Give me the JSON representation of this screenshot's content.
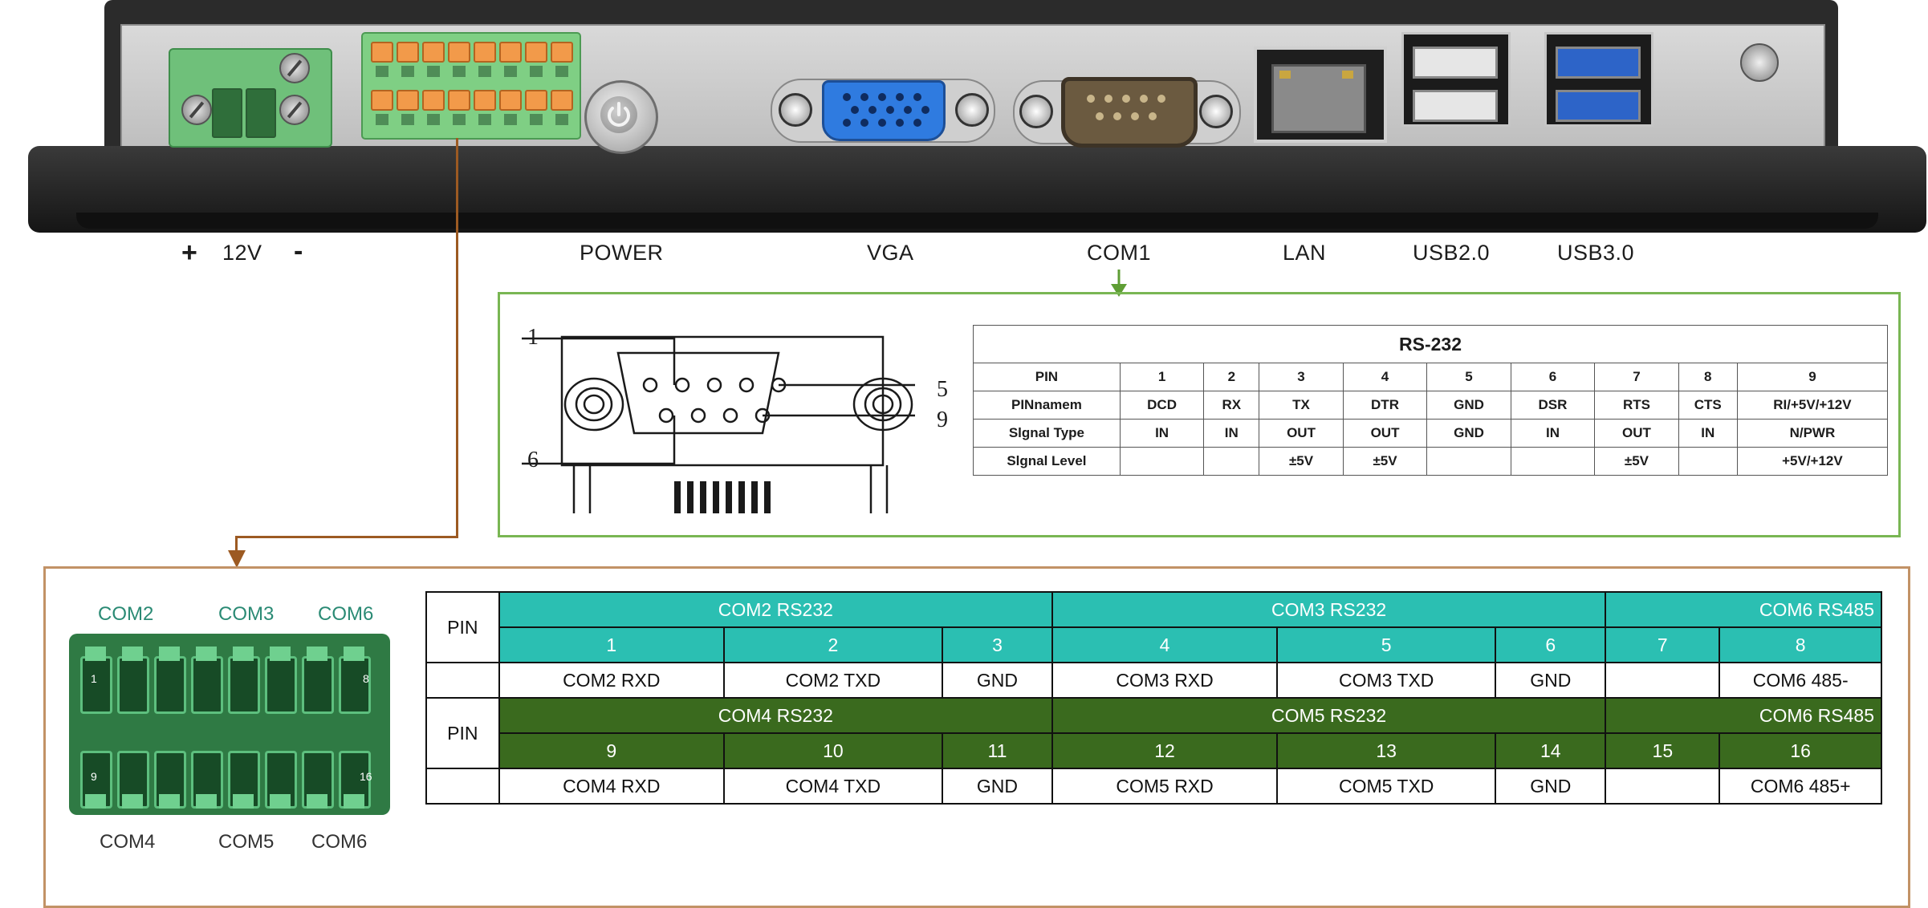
{
  "ports": {
    "power_plus": "+",
    "power_voltage": "12V",
    "power_minus": "-",
    "power_button": "POWER",
    "vga": "VGA",
    "com1": "COM1",
    "lan": "LAN",
    "usb2": "USB2.0",
    "usb3": "USB3.0"
  },
  "rs232_diagram": {
    "pin1_label": "1",
    "pin5_label": "5",
    "pin6_label": "6",
    "pin9_label": "9"
  },
  "rs232_table": {
    "title": "RS-232",
    "rows": [
      {
        "label": "PIN",
        "cells": [
          "1",
          "2",
          "3",
          "4",
          "5",
          "6",
          "7",
          "8",
          "9"
        ]
      },
      {
        "label": "PINnamem",
        "cells": [
          "DCD",
          "RX",
          "TX",
          "DTR",
          "GND",
          "DSR",
          "RTS",
          "CTS",
          "RI/+5V/+12V"
        ]
      },
      {
        "label": "Slgnal Type",
        "cells": [
          "IN",
          "IN",
          "OUT",
          "OUT",
          "GND",
          "IN",
          "OUT",
          "IN",
          "N/PWR"
        ]
      },
      {
        "label": "Slgnal Level",
        "cells": [
          "",
          "",
          "±5V",
          "±5V",
          "",
          "",
          "±5V",
          "",
          "+5V/+12V"
        ]
      }
    ]
  },
  "terminal_labels": {
    "top": [
      "COM2",
      "COM3",
      "COM6"
    ],
    "bottom": [
      "COM4",
      "COM5",
      "COM6"
    ],
    "pin_top_first": "1",
    "pin_top_last": "8",
    "pin_bottom_first": "9",
    "pin_bottom_last": "16"
  },
  "com_table": {
    "pin_label": "PIN",
    "top": {
      "groups": [
        "COM2 RS232",
        "COM3 RS232",
        "COM6 RS485"
      ],
      "pins": [
        "1",
        "2",
        "3",
        "4",
        "5",
        "6",
        "7",
        "8"
      ],
      "values": [
        "COM2 RXD",
        "COM2 TXD",
        "GND",
        "COM3 RXD",
        "COM3 TXD",
        "GND",
        "",
        "COM6 485-"
      ]
    },
    "bottom": {
      "groups": [
        "COM4 RS232",
        "COM5 RS232",
        "COM6 RS485"
      ],
      "pins": [
        "9",
        "10",
        "11",
        "12",
        "13",
        "14",
        "15",
        "16"
      ],
      "values": [
        "COM4 RXD",
        "COM4 TXD",
        "GND",
        "COM5 RXD",
        "COM5 TXD",
        "GND",
        "",
        "COM6 485+"
      ]
    }
  },
  "colors": {
    "teal_header": "#2bbfb2",
    "olive_header": "#3a6a1e",
    "green_border": "#79b653",
    "brown_border": "#c29266"
  }
}
